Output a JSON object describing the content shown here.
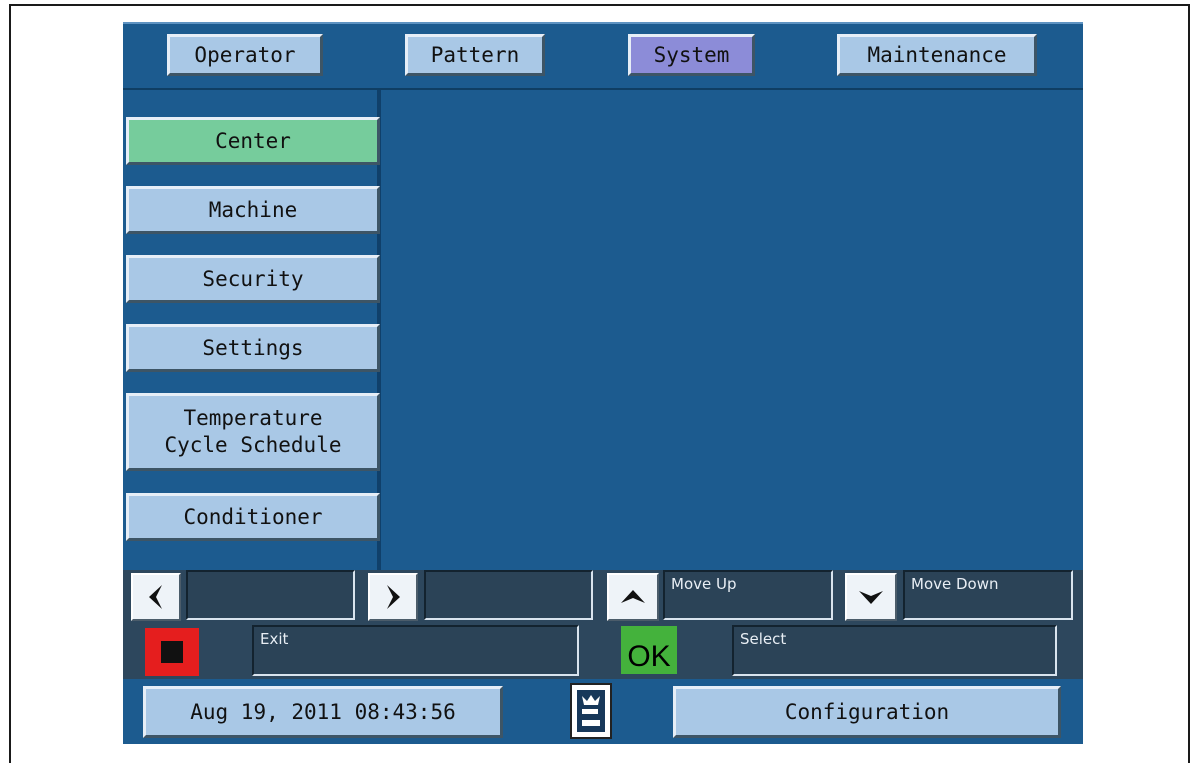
{
  "tabs": [
    {
      "label": "Operator",
      "selected": false
    },
    {
      "label": "Pattern",
      "selected": false
    },
    {
      "label": "System",
      "selected": true
    },
    {
      "label": "Maintenance",
      "selected": false
    }
  ],
  "sidebar": {
    "items": [
      {
        "label": "Center",
        "selected": true
      },
      {
        "label": "Machine",
        "selected": false
      },
      {
        "label": "Security",
        "selected": false
      },
      {
        "label": "Settings",
        "selected": false
      },
      {
        "label_line1": "Temperature",
        "label_line2": "Cycle Schedule",
        "selected": false
      },
      {
        "label": "Conditioner",
        "selected": false
      }
    ]
  },
  "softkeys": {
    "left_field": "",
    "right_field": "",
    "up_label": "Move Up",
    "down_label": "Move Down",
    "exit_label": "Exit",
    "ok_text": "OK",
    "select_label": "Select"
  },
  "footer": {
    "datetime": "Aug 19, 2011 08:43:56",
    "screen_title": "Configuration"
  },
  "colors": {
    "background": "#1c5b8f",
    "button": "#a9c8e6",
    "selected_menu": "#76cc9c",
    "selected_tab": "#8c8cd8",
    "exit_key": "#e51e1e",
    "ok_key": "#44b23c"
  }
}
